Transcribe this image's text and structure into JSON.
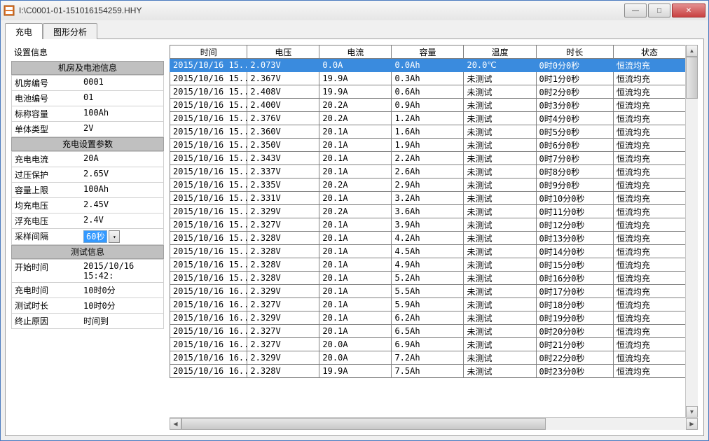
{
  "window": {
    "title": "I:\\C0001-01-151016154259.HHY",
    "buttons": {
      "min": "—",
      "max": "□",
      "close": "✕"
    }
  },
  "tabs": [
    {
      "label": "充电",
      "active": true
    },
    {
      "label": "图形分析",
      "active": false
    }
  ],
  "left": {
    "heading": "设置信息",
    "groups": [
      {
        "title": "机房及电池信息",
        "rows": [
          {
            "k": "机房编号",
            "v": "0001"
          },
          {
            "k": "电池编号",
            "v": "01"
          },
          {
            "k": "标称容量",
            "v": "100Ah"
          },
          {
            "k": "单体类型",
            "v": "2V"
          }
        ]
      },
      {
        "title": "充电设置参数",
        "rows": [
          {
            "k": "充电电流",
            "v": "20A"
          },
          {
            "k": "过压保护",
            "v": "2.65V"
          },
          {
            "k": "容量上限",
            "v": "100Ah"
          },
          {
            "k": "均充电压",
            "v": "2.45V"
          },
          {
            "k": "浮充电压",
            "v": "2.4V"
          },
          {
            "k": "采样间隔",
            "v": "60秒",
            "combo": true
          }
        ]
      },
      {
        "title": "测试信息",
        "rows": [
          {
            "k": "开始时间",
            "v": "2015/10/16 15:42:"
          },
          {
            "k": "充电时间",
            "v": "10时0分"
          },
          {
            "k": "测试时长",
            "v": "10时0分"
          },
          {
            "k": "终止原因",
            "v": "时间到"
          }
        ]
      }
    ]
  },
  "grid": {
    "headers": [
      "时间",
      "电压",
      "电流",
      "容量",
      "温度",
      "时长",
      "状态"
    ],
    "rows": [
      {
        "c": [
          "2015/10/16 15...",
          "2.073V",
          "0.0A",
          "0.0Ah",
          "20.0℃",
          "0时0分0秒",
          "恒流均充"
        ],
        "sel": true
      },
      {
        "c": [
          "2015/10/16 15...",
          "2.367V",
          "19.9A",
          "0.3Ah",
          "未测试",
          "0时1分0秒",
          "恒流均充"
        ]
      },
      {
        "c": [
          "2015/10/16 15...",
          "2.408V",
          "19.9A",
          "0.6Ah",
          "未测试",
          "0时2分0秒",
          "恒流均充"
        ]
      },
      {
        "c": [
          "2015/10/16 15...",
          "2.400V",
          "20.2A",
          "0.9Ah",
          "未测试",
          "0时3分0秒",
          "恒流均充"
        ]
      },
      {
        "c": [
          "2015/10/16 15...",
          "2.376V",
          "20.2A",
          "1.2Ah",
          "未测试",
          "0时4分0秒",
          "恒流均充"
        ]
      },
      {
        "c": [
          "2015/10/16 15...",
          "2.360V",
          "20.1A",
          "1.6Ah",
          "未测试",
          "0时5分0秒",
          "恒流均充"
        ]
      },
      {
        "c": [
          "2015/10/16 15...",
          "2.350V",
          "20.1A",
          "1.9Ah",
          "未测试",
          "0时6分0秒",
          "恒流均充"
        ]
      },
      {
        "c": [
          "2015/10/16 15...",
          "2.343V",
          "20.1A",
          "2.2Ah",
          "未测试",
          "0时7分0秒",
          "恒流均充"
        ]
      },
      {
        "c": [
          "2015/10/16 15...",
          "2.337V",
          "20.1A",
          "2.6Ah",
          "未测试",
          "0时8分0秒",
          "恒流均充"
        ]
      },
      {
        "c": [
          "2015/10/16 15...",
          "2.335V",
          "20.2A",
          "2.9Ah",
          "未测试",
          "0时9分0秒",
          "恒流均充"
        ]
      },
      {
        "c": [
          "2015/10/16 15...",
          "2.331V",
          "20.1A",
          "3.2Ah",
          "未测试",
          "0时10分0秒",
          "恒流均充"
        ]
      },
      {
        "c": [
          "2015/10/16 15...",
          "2.329V",
          "20.2A",
          "3.6Ah",
          "未测试",
          "0时11分0秒",
          "恒流均充"
        ]
      },
      {
        "c": [
          "2015/10/16 15...",
          "2.327V",
          "20.1A",
          "3.9Ah",
          "未测试",
          "0时12分0秒",
          "恒流均充"
        ]
      },
      {
        "c": [
          "2015/10/16 15...",
          "2.328V",
          "20.1A",
          "4.2Ah",
          "未测试",
          "0时13分0秒",
          "恒流均充"
        ]
      },
      {
        "c": [
          "2015/10/16 15...",
          "2.328V",
          "20.1A",
          "4.5Ah",
          "未测试",
          "0时14分0秒",
          "恒流均充"
        ]
      },
      {
        "c": [
          "2015/10/16 15...",
          "2.328V",
          "20.1A",
          "4.9Ah",
          "未测试",
          "0时15分0秒",
          "恒流均充"
        ]
      },
      {
        "c": [
          "2015/10/16 15...",
          "2.328V",
          "20.1A",
          "5.2Ah",
          "未测试",
          "0时16分0秒",
          "恒流均充"
        ]
      },
      {
        "c": [
          "2015/10/16 16...",
          "2.329V",
          "20.1A",
          "5.5Ah",
          "未测试",
          "0时17分0秒",
          "恒流均充"
        ]
      },
      {
        "c": [
          "2015/10/16 16...",
          "2.327V",
          "20.1A",
          "5.9Ah",
          "未测试",
          "0时18分0秒",
          "恒流均充"
        ]
      },
      {
        "c": [
          "2015/10/16 16...",
          "2.329V",
          "20.1A",
          "6.2Ah",
          "未测试",
          "0时19分0秒",
          "恒流均充"
        ]
      },
      {
        "c": [
          "2015/10/16 16...",
          "2.327V",
          "20.1A",
          "6.5Ah",
          "未测试",
          "0时20分0秒",
          "恒流均充"
        ]
      },
      {
        "c": [
          "2015/10/16 16...",
          "2.327V",
          "20.0A",
          "6.9Ah",
          "未测试",
          "0时21分0秒",
          "恒流均充"
        ]
      },
      {
        "c": [
          "2015/10/16 16...",
          "2.329V",
          "20.0A",
          "7.2Ah",
          "未测试",
          "0时22分0秒",
          "恒流均充"
        ]
      },
      {
        "c": [
          "2015/10/16 16...",
          "2.328V",
          "19.9A",
          "7.5Ah",
          "未测试",
          "0时23分0秒",
          "恒流均充"
        ]
      }
    ]
  }
}
